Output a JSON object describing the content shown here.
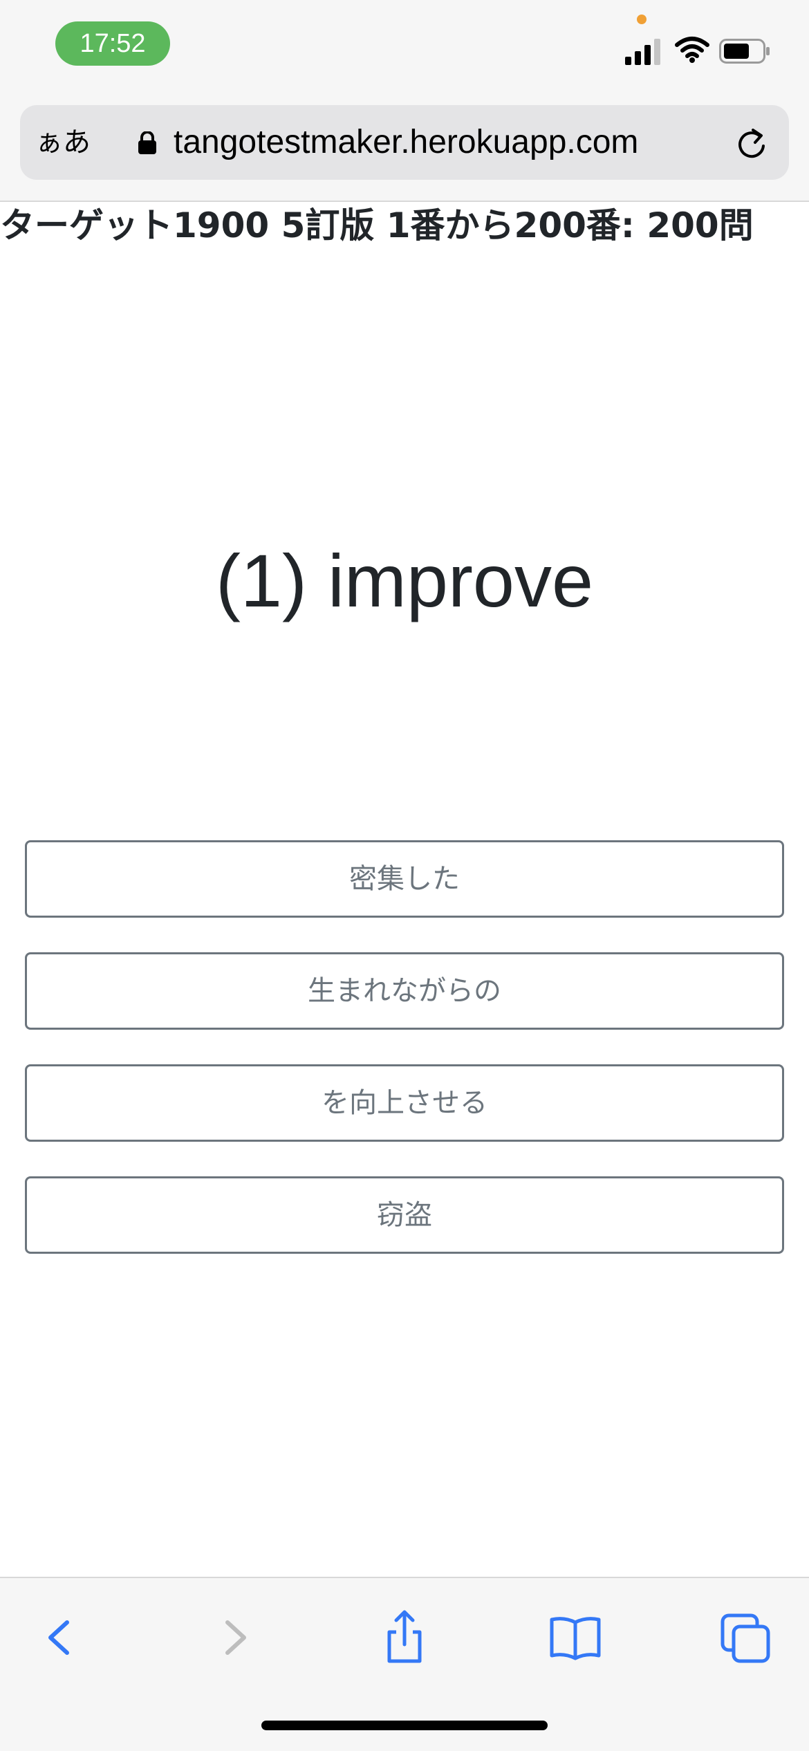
{
  "status_bar": {
    "time": "17:52"
  },
  "browser": {
    "text_size_button": "ぁあ",
    "url": "tangotestmaker.herokuapp.com"
  },
  "page": {
    "title": "ターゲット1900 5訂版 1番から200番: 200問",
    "question": "(1) improve",
    "choices": [
      "密集した",
      "生まれながらの",
      "を向上させる",
      "窃盗"
    ]
  },
  "colors": {
    "time_pill": "#5cb85c",
    "toolbar_accent": "#3478f6",
    "choice_border": "#6c757d"
  }
}
